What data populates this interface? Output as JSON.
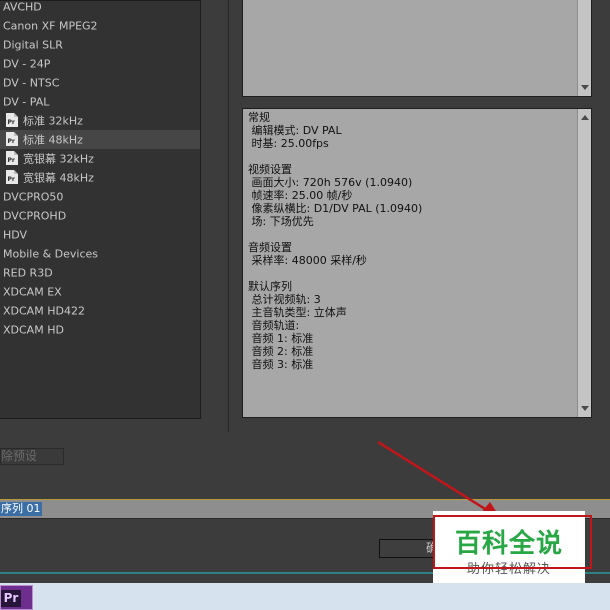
{
  "presets": [
    {
      "label": "AVCHD",
      "type": "folder"
    },
    {
      "label": "Canon XF MPEG2",
      "type": "folder"
    },
    {
      "label": "Digital SLR",
      "type": "folder"
    },
    {
      "label": "DV - 24P",
      "type": "folder"
    },
    {
      "label": "DV - NTSC",
      "type": "folder"
    },
    {
      "label": "DV - PAL",
      "type": "folder"
    },
    {
      "label": "标准 32kHz",
      "type": "file"
    },
    {
      "label": "标准 48kHz",
      "type": "file",
      "selected": true
    },
    {
      "label": "宽银幕 32kHz",
      "type": "file"
    },
    {
      "label": "宽银幕 48kHz",
      "type": "file"
    },
    {
      "label": "DVCPRO50",
      "type": "folder"
    },
    {
      "label": "DVCPROHD",
      "type": "folder"
    },
    {
      "label": "HDV",
      "type": "folder"
    },
    {
      "label": "Mobile & Devices",
      "type": "folder"
    },
    {
      "label": "RED R3D",
      "type": "folder"
    },
    {
      "label": "XDCAM EX",
      "type": "folder"
    },
    {
      "label": "XDCAM HD422",
      "type": "folder"
    },
    {
      "label": "XDCAM HD",
      "type": "folder"
    }
  ],
  "description": [
    "常规",
    " 编辑模式: DV PAL",
    " 时基: 25.00fps",
    "",
    "视频设置",
    " 画面大小: 720h 576v (1.0940)",
    " 帧速率: 25.00 帧/秒",
    " 像素纵横比: D1/DV PAL (1.0940)",
    " 场: 下场优先",
    "",
    "音频设置",
    " 采样率: 48000 采样/秒",
    "",
    "默认序列",
    " 总计视频轨: 3",
    " 主音轨类型: 立体声",
    " 音频轨道:",
    " 音频 1: 标准",
    " 音频 2: 标准",
    " 音频 3: 标准"
  ],
  "delete_preset_label": "除预设",
  "sequence_name": "序列 01",
  "ok_label": "确",
  "taskbar": {
    "app_label": "Pr"
  },
  "watermark": {
    "title": "百科全说",
    "subtitle": "助你轻松解决"
  },
  "colors": {
    "annotation_red": "#c0161a",
    "selection_blue": "#3a6ea5"
  }
}
